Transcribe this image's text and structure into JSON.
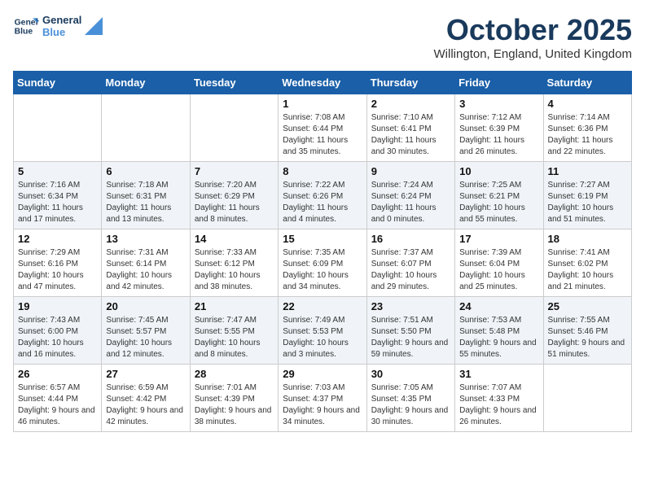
{
  "logo": {
    "line1": "General",
    "line2": "Blue"
  },
  "title": "October 2025",
  "location": "Willington, England, United Kingdom",
  "days_of_week": [
    "Sunday",
    "Monday",
    "Tuesday",
    "Wednesday",
    "Thursday",
    "Friday",
    "Saturday"
  ],
  "weeks": [
    [
      {
        "day": "",
        "sunrise": "",
        "sunset": "",
        "daylight": ""
      },
      {
        "day": "",
        "sunrise": "",
        "sunset": "",
        "daylight": ""
      },
      {
        "day": "",
        "sunrise": "",
        "sunset": "",
        "daylight": ""
      },
      {
        "day": "1",
        "sunrise": "Sunrise: 7:08 AM",
        "sunset": "Sunset: 6:44 PM",
        "daylight": "Daylight: 11 hours and 35 minutes."
      },
      {
        "day": "2",
        "sunrise": "Sunrise: 7:10 AM",
        "sunset": "Sunset: 6:41 PM",
        "daylight": "Daylight: 11 hours and 30 minutes."
      },
      {
        "day": "3",
        "sunrise": "Sunrise: 7:12 AM",
        "sunset": "Sunset: 6:39 PM",
        "daylight": "Daylight: 11 hours and 26 minutes."
      },
      {
        "day": "4",
        "sunrise": "Sunrise: 7:14 AM",
        "sunset": "Sunset: 6:36 PM",
        "daylight": "Daylight: 11 hours and 22 minutes."
      }
    ],
    [
      {
        "day": "5",
        "sunrise": "Sunrise: 7:16 AM",
        "sunset": "Sunset: 6:34 PM",
        "daylight": "Daylight: 11 hours and 17 minutes."
      },
      {
        "day": "6",
        "sunrise": "Sunrise: 7:18 AM",
        "sunset": "Sunset: 6:31 PM",
        "daylight": "Daylight: 11 hours and 13 minutes."
      },
      {
        "day": "7",
        "sunrise": "Sunrise: 7:20 AM",
        "sunset": "Sunset: 6:29 PM",
        "daylight": "Daylight: 11 hours and 8 minutes."
      },
      {
        "day": "8",
        "sunrise": "Sunrise: 7:22 AM",
        "sunset": "Sunset: 6:26 PM",
        "daylight": "Daylight: 11 hours and 4 minutes."
      },
      {
        "day": "9",
        "sunrise": "Sunrise: 7:24 AM",
        "sunset": "Sunset: 6:24 PM",
        "daylight": "Daylight: 11 hours and 0 minutes."
      },
      {
        "day": "10",
        "sunrise": "Sunrise: 7:25 AM",
        "sunset": "Sunset: 6:21 PM",
        "daylight": "Daylight: 10 hours and 55 minutes."
      },
      {
        "day": "11",
        "sunrise": "Sunrise: 7:27 AM",
        "sunset": "Sunset: 6:19 PM",
        "daylight": "Daylight: 10 hours and 51 minutes."
      }
    ],
    [
      {
        "day": "12",
        "sunrise": "Sunrise: 7:29 AM",
        "sunset": "Sunset: 6:16 PM",
        "daylight": "Daylight: 10 hours and 47 minutes."
      },
      {
        "day": "13",
        "sunrise": "Sunrise: 7:31 AM",
        "sunset": "Sunset: 6:14 PM",
        "daylight": "Daylight: 10 hours and 42 minutes."
      },
      {
        "day": "14",
        "sunrise": "Sunrise: 7:33 AM",
        "sunset": "Sunset: 6:12 PM",
        "daylight": "Daylight: 10 hours and 38 minutes."
      },
      {
        "day": "15",
        "sunrise": "Sunrise: 7:35 AM",
        "sunset": "Sunset: 6:09 PM",
        "daylight": "Daylight: 10 hours and 34 minutes."
      },
      {
        "day": "16",
        "sunrise": "Sunrise: 7:37 AM",
        "sunset": "Sunset: 6:07 PM",
        "daylight": "Daylight: 10 hours and 29 minutes."
      },
      {
        "day": "17",
        "sunrise": "Sunrise: 7:39 AM",
        "sunset": "Sunset: 6:04 PM",
        "daylight": "Daylight: 10 hours and 25 minutes."
      },
      {
        "day": "18",
        "sunrise": "Sunrise: 7:41 AM",
        "sunset": "Sunset: 6:02 PM",
        "daylight": "Daylight: 10 hours and 21 minutes."
      }
    ],
    [
      {
        "day": "19",
        "sunrise": "Sunrise: 7:43 AM",
        "sunset": "Sunset: 6:00 PM",
        "daylight": "Daylight: 10 hours and 16 minutes."
      },
      {
        "day": "20",
        "sunrise": "Sunrise: 7:45 AM",
        "sunset": "Sunset: 5:57 PM",
        "daylight": "Daylight: 10 hours and 12 minutes."
      },
      {
        "day": "21",
        "sunrise": "Sunrise: 7:47 AM",
        "sunset": "Sunset: 5:55 PM",
        "daylight": "Daylight: 10 hours and 8 minutes."
      },
      {
        "day": "22",
        "sunrise": "Sunrise: 7:49 AM",
        "sunset": "Sunset: 5:53 PM",
        "daylight": "Daylight: 10 hours and 3 minutes."
      },
      {
        "day": "23",
        "sunrise": "Sunrise: 7:51 AM",
        "sunset": "Sunset: 5:50 PM",
        "daylight": "Daylight: 9 hours and 59 minutes."
      },
      {
        "day": "24",
        "sunrise": "Sunrise: 7:53 AM",
        "sunset": "Sunset: 5:48 PM",
        "daylight": "Daylight: 9 hours and 55 minutes."
      },
      {
        "day": "25",
        "sunrise": "Sunrise: 7:55 AM",
        "sunset": "Sunset: 5:46 PM",
        "daylight": "Daylight: 9 hours and 51 minutes."
      }
    ],
    [
      {
        "day": "26",
        "sunrise": "Sunrise: 6:57 AM",
        "sunset": "Sunset: 4:44 PM",
        "daylight": "Daylight: 9 hours and 46 minutes."
      },
      {
        "day": "27",
        "sunrise": "Sunrise: 6:59 AM",
        "sunset": "Sunset: 4:42 PM",
        "daylight": "Daylight: 9 hours and 42 minutes."
      },
      {
        "day": "28",
        "sunrise": "Sunrise: 7:01 AM",
        "sunset": "Sunset: 4:39 PM",
        "daylight": "Daylight: 9 hours and 38 minutes."
      },
      {
        "day": "29",
        "sunrise": "Sunrise: 7:03 AM",
        "sunset": "Sunset: 4:37 PM",
        "daylight": "Daylight: 9 hours and 34 minutes."
      },
      {
        "day": "30",
        "sunrise": "Sunrise: 7:05 AM",
        "sunset": "Sunset: 4:35 PM",
        "daylight": "Daylight: 9 hours and 30 minutes."
      },
      {
        "day": "31",
        "sunrise": "Sunrise: 7:07 AM",
        "sunset": "Sunset: 4:33 PM",
        "daylight": "Daylight: 9 hours and 26 minutes."
      },
      {
        "day": "",
        "sunrise": "",
        "sunset": "",
        "daylight": ""
      }
    ]
  ]
}
